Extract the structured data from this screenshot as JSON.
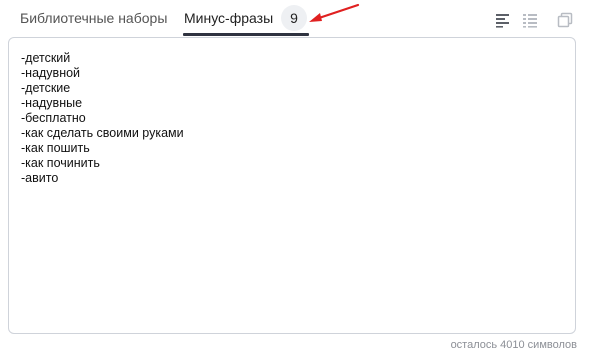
{
  "tabs": {
    "library_label": "Библиотечные наборы",
    "minus_label": "Минус-фразы",
    "minus_count": "9"
  },
  "toolbar": {
    "icons": [
      "align-left-icon",
      "list-icon",
      "copy-icon"
    ]
  },
  "editor": {
    "lines": [
      "-детский",
      "-надувной",
      "-детские",
      "-надувные",
      "-бесплатно",
      "-как сделать своими руками",
      "-как пошить",
      "-как починить",
      "-авито"
    ]
  },
  "counter_text": "осталось 4010 символов",
  "colors": {
    "accent_underline": "#2f3340",
    "arrow": "#e02020",
    "border": "#cfd3da",
    "muted_text": "#8c8f96"
  }
}
